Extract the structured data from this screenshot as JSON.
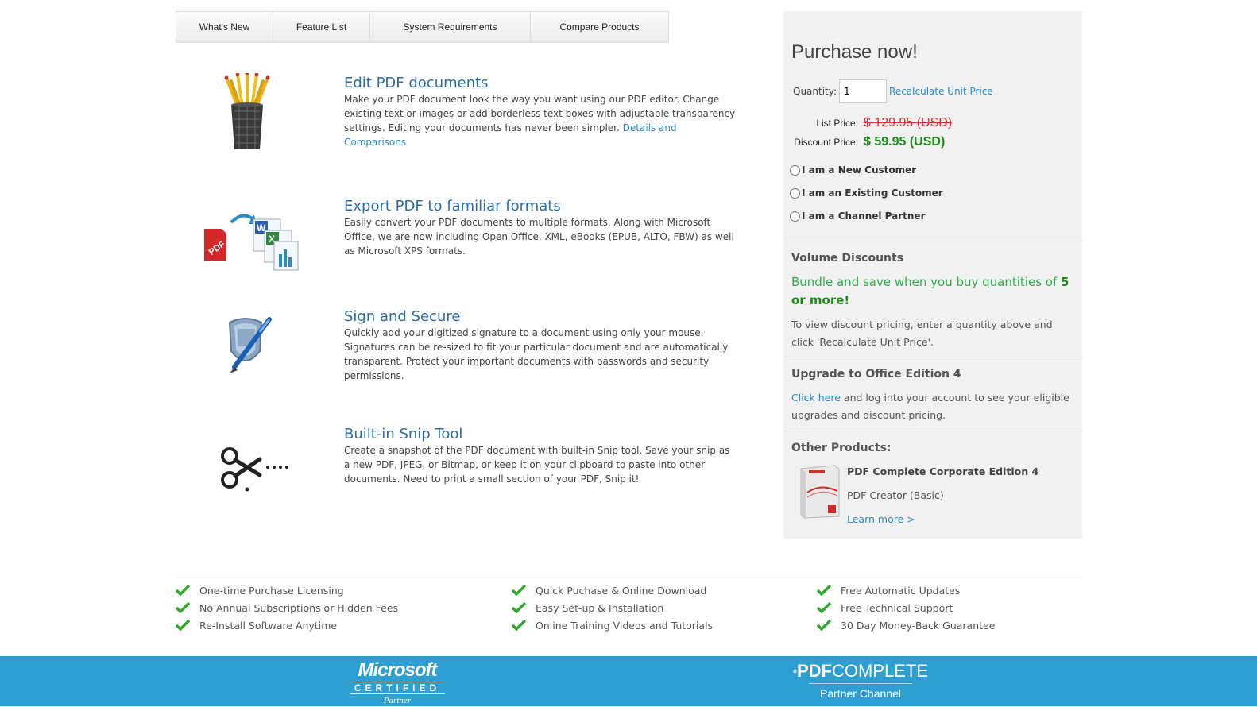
{
  "tabs": [
    {
      "label": "What's New"
    },
    {
      "label": "Feature List"
    },
    {
      "label": "System Requirements"
    },
    {
      "label": "Compare Products"
    }
  ],
  "features": [
    {
      "title": "Edit PDF documents",
      "body": "Make your PDF document look the way you want using our PDF editor. Change existing text or images or add borderless text boxes with adjustable transparency settings. Editing your documents has never been simpler.",
      "link": "Details and Comparisons",
      "icon": "pencil-cup-icon"
    },
    {
      "title": "Export PDF to familiar formats",
      "body": "Easily convert your PDF documents to multiple formats. Along with Microsoft Office, we are now including Open Office, XML, eBooks (EPUB, ALTO, FBW) as well as Microsoft XPS formats.",
      "icon": "pdf-export-icon"
    },
    {
      "title": "Sign and Secure",
      "body": "Quickly add your digitized signature to a document using only your mouse. Signatures can be re-sized to fit your particular document and are automatically transparent. Protect your important documents with passwords and security permissions.",
      "icon": "shield-pen-icon"
    },
    {
      "title": "Built-in Snip Tool",
      "body": "Create a snapshot of the PDF document with built-in Snip tool. Save your snip as a new PDF, JPEG, or Bitmap, or keep it on your clipboard to paste into other documents. Need to print a small section of your PDF, Snip it!",
      "icon": "scissors-icon"
    }
  ],
  "purchase": {
    "heading": "Purchase now!",
    "quantity_label": "Quantity:",
    "quantity_value": "1",
    "recalc_link": "Recalculate Unit Price",
    "list_price_label": "List Price:",
    "list_price_value": "$ 129.95 (USD)",
    "discount_price_label": "Discount Price:",
    "discount_price_value": "$ 59.95 (USD)",
    "customer_options": [
      "I am a New Customer",
      "I am an Existing Customer",
      "I am a Channel Partner"
    ]
  },
  "volume": {
    "title": "Volume Discounts",
    "bundle_text": "Bundle and save when you buy quantities of",
    "bundle_bold": "5 or more!",
    "note": "To view discount pricing, enter a quantity above and click 'Recalculate Unit Price'."
  },
  "upgrade": {
    "title": "Upgrade to Office Edition 4",
    "link": "Click here",
    "text": "and log into your account to see your eligible upgrades and discount pricing."
  },
  "other_products": {
    "title": "Other Products:",
    "product_name": "PDF Complete Corporate Edition 4",
    "product_sub": "PDF Creator (Basic)",
    "learn_more": "Learn more >"
  },
  "benefits": [
    [
      "One-time Purchase Licensing",
      "No Annual Subscriptions or Hidden Fees",
      "Re-Install Software Anytime"
    ],
    [
      "Quick Puchase & Online Download",
      "Easy Set-up & Installation",
      "Online Training Videos and Tutorials"
    ],
    [
      "Free Automatic Updates",
      "Free Technical Support",
      "30 Day Money-Back Guarantee"
    ]
  ],
  "footer": {
    "ms_word": "Microsoft",
    "ms_cert": "CERTIFIED",
    "ms_partner": "Partner",
    "pc_word_bold": "PDF",
    "pc_word_light": "COMPLETE",
    "pc_partner": "Partner Channel"
  },
  "colors": {
    "link": "#2a8cc7",
    "heading_blue": "#2a6ea8",
    "list_price": "#d9322d",
    "discount_price": "#1c8a1c",
    "bundle_green": "#2fae4e",
    "footer_bg": "#2e9fd3",
    "check_green": "#2fa82f"
  }
}
